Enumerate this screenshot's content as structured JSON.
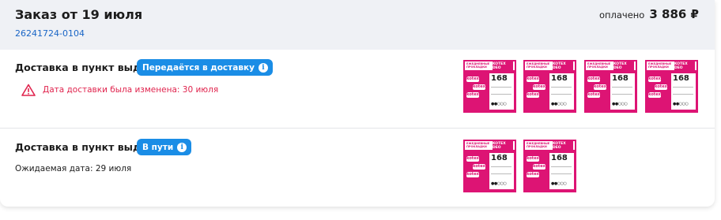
{
  "header": {
    "title": "Заказ от 19 июля",
    "order_number": "26241724-0104",
    "paid_label": "оплачено",
    "paid_amount": "3 886 ₽"
  },
  "shipments": [
    {
      "title": "Доставка в пункт выдачи",
      "status": "Передаётся в доставку",
      "note": "Дата доставки была изменена: 30 июля",
      "product_count": 4
    },
    {
      "title": "Доставка в пункт выдачи",
      "status": "В пути",
      "expected": "Ожидаемая дата: 29 июля",
      "product_count": 2
    }
  ],
  "product": {
    "top_label": "ЕЖЕДНЕВНЫЕ ПРОКЛАДКИ",
    "top_right": "KOTEX DEO",
    "brand": "kotex",
    "count": "168"
  },
  "colors": {
    "badge": "#1a8de6",
    "warning": "#e0234d",
    "link": "#1a66c6",
    "product_pink": "#dd1474"
  }
}
